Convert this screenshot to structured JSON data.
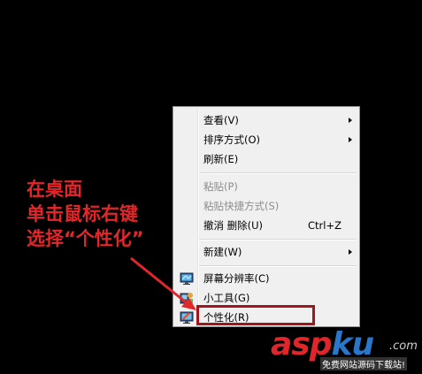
{
  "context_menu": {
    "items": [
      {
        "label": "查看(V)",
        "submenu": true
      },
      {
        "label": "排序方式(O)",
        "submenu": true
      },
      {
        "label": "刷新(E)"
      },
      {
        "label": "粘贴(P)",
        "disabled": true
      },
      {
        "label": "粘贴快捷方式(S)",
        "disabled": true
      },
      {
        "label": "撤消 删除(U)",
        "shortcut": "Ctrl+Z"
      },
      {
        "label": "新建(W)",
        "submenu": true
      },
      {
        "label": "屏幕分辨率(C)",
        "icon": "monitor-icon"
      },
      {
        "label": "小工具(G)",
        "icon": "gadgets-icon"
      },
      {
        "label": "个性化(R)",
        "icon": "personalize-icon"
      }
    ]
  },
  "annotation": {
    "line1": "在桌面",
    "line2": "单击鼠标右键",
    "line3": "选择“个性化”"
  },
  "watermark": {
    "logo_part1": "asp",
    "logo_part2": "ku",
    "tld": ".com",
    "tagline": "免费网站源码下载站!"
  },
  "colors": {
    "annotation": "#e3262a",
    "highlight_box": "#a0161b",
    "menu_bg": "#f0f0f0",
    "disabled_text": "#8d8d8d"
  }
}
